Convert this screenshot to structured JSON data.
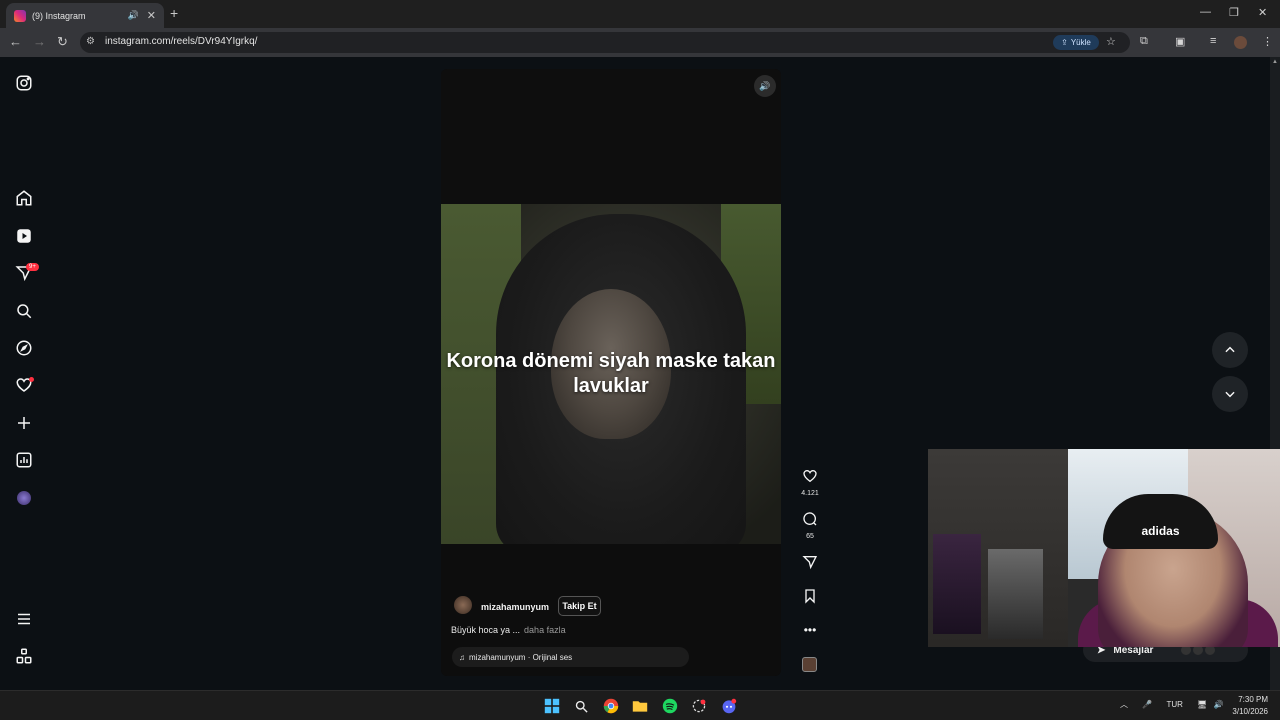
{
  "browser": {
    "tab_title": "(9) Instagram",
    "url": "instagram.com/reels/DVr94YIgrkq/",
    "upload_label": "Yükle"
  },
  "sidebar": {
    "messages_badge": "9+"
  },
  "reel": {
    "caption": "Korona dönemi siyah maske takan lavuklar",
    "author": "mizahamunyum",
    "follow_label": "Takip Et",
    "description": "Büyük hoca ya ...",
    "more_label": "daha fazla",
    "audio": "mizahamunyum · Orijinal ses",
    "likes": "4.121",
    "comments": "65"
  },
  "messages": {
    "label": "Mesajlar"
  },
  "webcam": {
    "cap_text": "adidas"
  },
  "taskbar": {
    "language": "TUR",
    "time": "7:30 PM",
    "date": "3/10/2026"
  },
  "colors": {
    "background": "#0c1014",
    "notification": "#ff3040",
    "upload_pill": "#1f3b5a"
  }
}
